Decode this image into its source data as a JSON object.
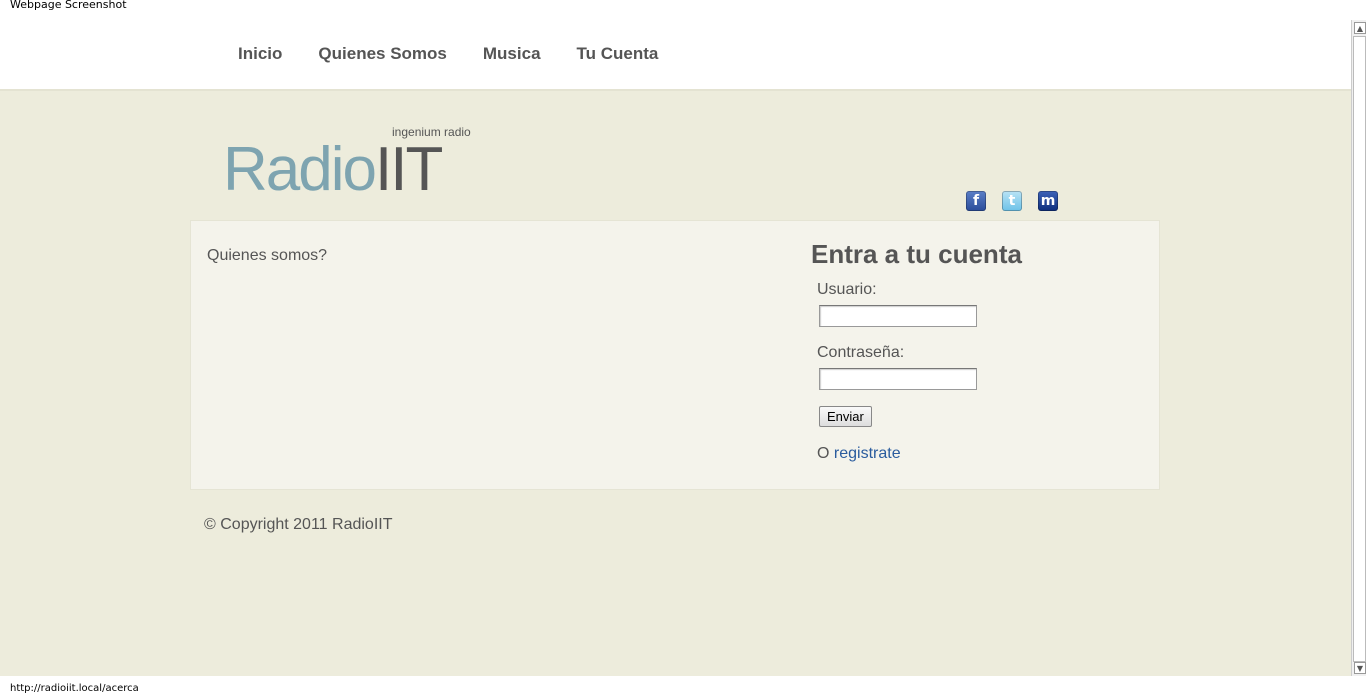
{
  "window": {
    "title": "Webpage Screenshot"
  },
  "nav": {
    "items": [
      "Inicio",
      "Quienes Somos",
      "Musica",
      "Tu Cuenta"
    ]
  },
  "header": {
    "tagline": "ingenium radio",
    "logo_part1": "Radio",
    "logo_part2": "IIT",
    "social": [
      {
        "name": "facebook-icon",
        "glyph": "f"
      },
      {
        "name": "twitter-icon",
        "glyph": "t"
      },
      {
        "name": "myspace-icon",
        "glyph": "m"
      }
    ]
  },
  "main": {
    "about": "Quienes somos?",
    "login": {
      "title": "Entra a tu cuenta",
      "user_label": "Usuario:",
      "user_value": "",
      "pass_label": "Contraseña:",
      "pass_value": "",
      "submit": "Enviar",
      "register_prefix": "O",
      "register_link": "registrate"
    }
  },
  "footer": {
    "copyright": "© Copyright 2011 RadioIIT"
  },
  "status": {
    "url": "http://radioiit.local/acerca"
  }
}
